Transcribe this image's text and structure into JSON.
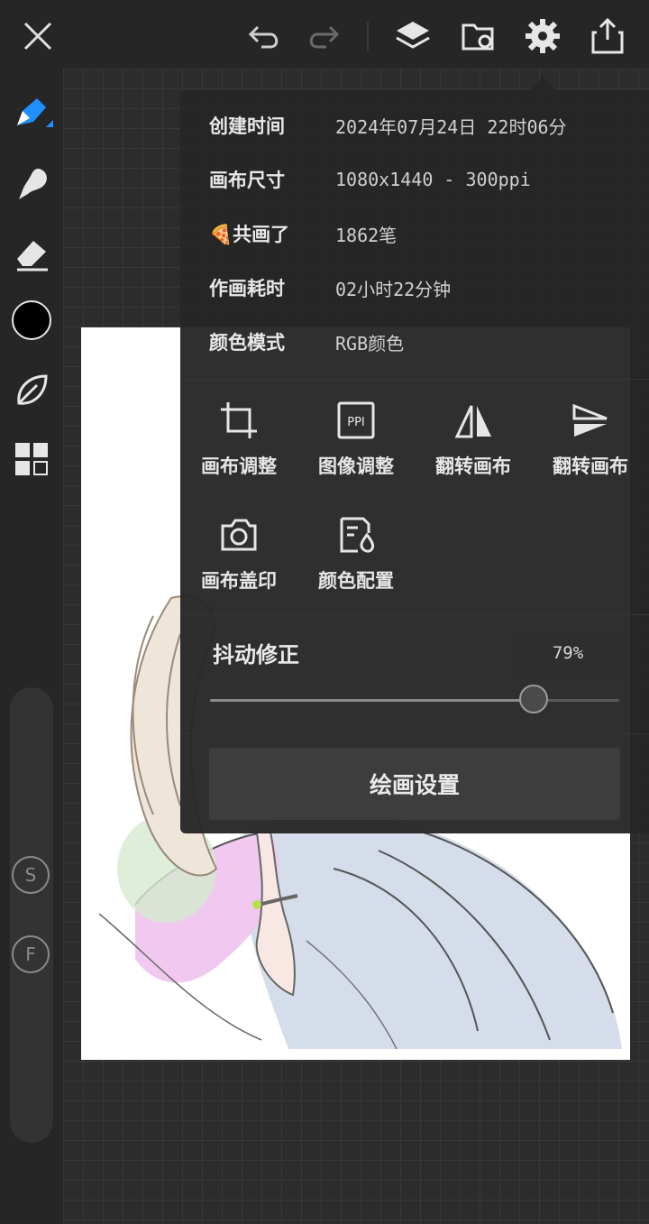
{
  "topbar": {
    "icons": [
      "close-icon",
      "undo-icon",
      "redo-icon",
      "layers-icon",
      "folder-icon",
      "gear-icon",
      "share-icon"
    ]
  },
  "sidebar": {
    "current_color": "#000000",
    "accent": "#1e90ff",
    "s_label": "S",
    "f_label": "F"
  },
  "info": [
    {
      "label": "创建时间",
      "value": "2024年07月24日 22时06分"
    },
    {
      "label": "画布尺寸",
      "value": "1080x1440 - 300ppi"
    },
    {
      "label": "🍕共画了",
      "value": "1862笔"
    },
    {
      "label": "作画耗时",
      "value": "02小时22分钟"
    },
    {
      "label": "颜色模式",
      "value": "RGB颜色"
    }
  ],
  "tools": [
    {
      "label": "画布调整",
      "icon": "crop-icon"
    },
    {
      "label": "图像调整",
      "icon": "ppi-icon",
      "icon_text": "PPI"
    },
    {
      "label": "翻转画布",
      "icon": "flip-horizontal-icon"
    },
    {
      "label": "翻转画布",
      "icon": "flip-vertical-icon"
    },
    {
      "label": "画布盖印",
      "icon": "camera-icon"
    },
    {
      "label": "颜色配置",
      "icon": "color-profile-icon"
    }
  ],
  "jitter": {
    "label": "抖动修正",
    "value_text": "79%",
    "value": 0.79
  },
  "settings_button": "绘画设置"
}
